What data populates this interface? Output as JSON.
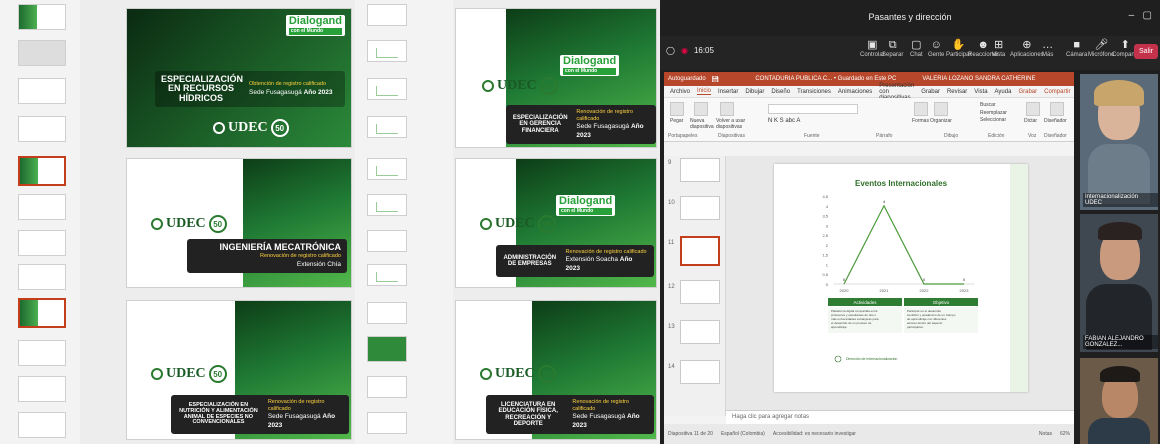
{
  "left_grid": {
    "slides": [
      {
        "id": "s1",
        "title": "ESPECIALIZACIÓN EN RECURSOS HÍDRICOS",
        "subtitle": "Obtención de registro calificado",
        "location": "Sede Fusagasugá",
        "year": "Año 2023",
        "brand": "Dialogand",
        "brand_sub": "con el Mundo",
        "logo": "UDEC"
      },
      {
        "id": "s2",
        "title": "ESPECIALIZACIÓN EN GERENCIA FINANCIERA",
        "subtitle": "Renovación de registro calificado",
        "location": "Sede Fusagasugá",
        "year": "Año 2023",
        "brand": "Dialogand",
        "brand_sub": "con el Mundo",
        "logo": "UDEC"
      },
      {
        "id": "s3",
        "title": "INGENIERÍA MECATRÓNICA",
        "subtitle": "Renovación de registro calificado",
        "location": "Extensión Chía",
        "logo": "UDEC"
      },
      {
        "id": "s4",
        "title": "ADMINISTRACIÓN DE EMPRESAS",
        "subtitle": "Renovación de registro calificado",
        "location": "Extensión Soacha",
        "year": "Año 2023",
        "brand": "Dialogand",
        "brand_sub": "con el Mundo",
        "logo": "UDEC"
      },
      {
        "id": "s5",
        "title": "ESPECIALIZACIÓN EN NUTRICIÓN Y ALIMENTACIÓN ANIMAL DE ESPECIES NO CONVENCIONALES",
        "subtitle": "Renovación de registro calificado",
        "location": "Sede Fusagasugá",
        "year": "Año 2023",
        "logo": "UDEC"
      },
      {
        "id": "s6",
        "title": "LICENCIATURA EN EDUCACIÓN FÍSICA, RECREACIÓN Y DEPORTE",
        "subtitle": "Renovación de registro calificado",
        "location": "Sede Fusagasugá",
        "year": "Año 2023",
        "logo": "UDEC"
      }
    ],
    "udec_label": "UDEC",
    "fifty_label": "50"
  },
  "teams": {
    "window_title": "Pasantes y dirección",
    "timer": "16:05",
    "tools": [
      {
        "label": "Controlar",
        "icon": "control-icon"
      },
      {
        "label": "Separar",
        "icon": "pop-out-icon"
      },
      {
        "label": "Chat",
        "icon": "chat-icon"
      },
      {
        "label": "Gente",
        "icon": "people-icon"
      },
      {
        "label": "Participar",
        "icon": "raise-hand-icon"
      },
      {
        "label": "Reaccionar",
        "icon": "react-icon"
      },
      {
        "label": "Vista",
        "icon": "view-icon"
      },
      {
        "label": "Aplicaciones",
        "icon": "apps-icon"
      },
      {
        "label": "Más",
        "icon": "more-icon"
      },
      {
        "label": "Cámara",
        "icon": "camera-icon"
      },
      {
        "label": "Micrófono",
        "icon": "mic-icon"
      },
      {
        "label": "Compartir",
        "icon": "share-icon"
      }
    ],
    "leave_label": "Salir",
    "participants": [
      {
        "name": "Internacionalización UDEC"
      },
      {
        "name": "FABIAN ALEJANDRO GONZALEZ..."
      },
      {
        "name": ""
      }
    ]
  },
  "ppt": {
    "autosave": "Autoguardado",
    "doc_title": "CONTADURIA PUBLICA C... • Guardado en Este PC",
    "user": "VALERIA LOZANO SANDRA CATHERINE",
    "tabs": [
      "Archivo",
      "Inicio",
      "Insertar",
      "Dibujar",
      "Diseño",
      "Transiciones",
      "Animaciones",
      "Presentación con diapositivas",
      "Grabar",
      "Revisar",
      "Vista",
      "Ayuda"
    ],
    "active_tab": "Inicio",
    "record_btn": "Grabar",
    "share_btn": "Compartir",
    "ribbon_groups": [
      "Portapapeles",
      "Diapositivas",
      "Fuente",
      "Párrafo",
      "Dibujo",
      "Edición",
      "Voz",
      "Diseñador"
    ],
    "ribbon_buttons": [
      "Pegar",
      "Nueva diapositiva",
      "Volver a usar diapositivas",
      "Formas",
      "Organizar",
      "Estilos rápidos",
      "Buscar",
      "Reemplazar",
      "Seleccionar",
      "Dictar",
      "Diseñador"
    ],
    "slide_numbers": [
      "9",
      "10",
      "11",
      "12",
      "13",
      "14"
    ],
    "notes_placeholder": "Haga clic para agregar notas",
    "status_left": "Diapositiva 11 de 20",
    "status_lang": "Español (Colombia)",
    "status_access": "Accesibilidad: es necesario investigar",
    "status_notes": "Notas",
    "zoom": "62%"
  },
  "slide_content": {
    "chart_title": "Eventos Internacionales",
    "col1": "Actividades",
    "col2": "Objetivo",
    "col1_text": "Plataforma digital compartida entre profesores y estudiantes de dos o más universidades extranjeras para el desarrollo de un proceso de aprendizaje.",
    "col2_text": "Participar en el desarrollo científico y académico de un Campo de aprendizaje con diferentes actores dentro del aspecto participativo.",
    "footer_left": "Dirección de Internacionalización"
  },
  "chart_data": {
    "type": "line",
    "title": "Eventos Internacionales",
    "categories": [
      "2020",
      "2021",
      "2022",
      "2023"
    ],
    "values": [
      0,
      4,
      0,
      0
    ],
    "ylim": [
      0,
      4.5
    ],
    "yticks": [
      "0",
      "0,5",
      "1",
      "1,5",
      "2",
      "2,5",
      "3",
      "3,5",
      "4",
      "4,5"
    ],
    "color": "#4a9a3a"
  }
}
